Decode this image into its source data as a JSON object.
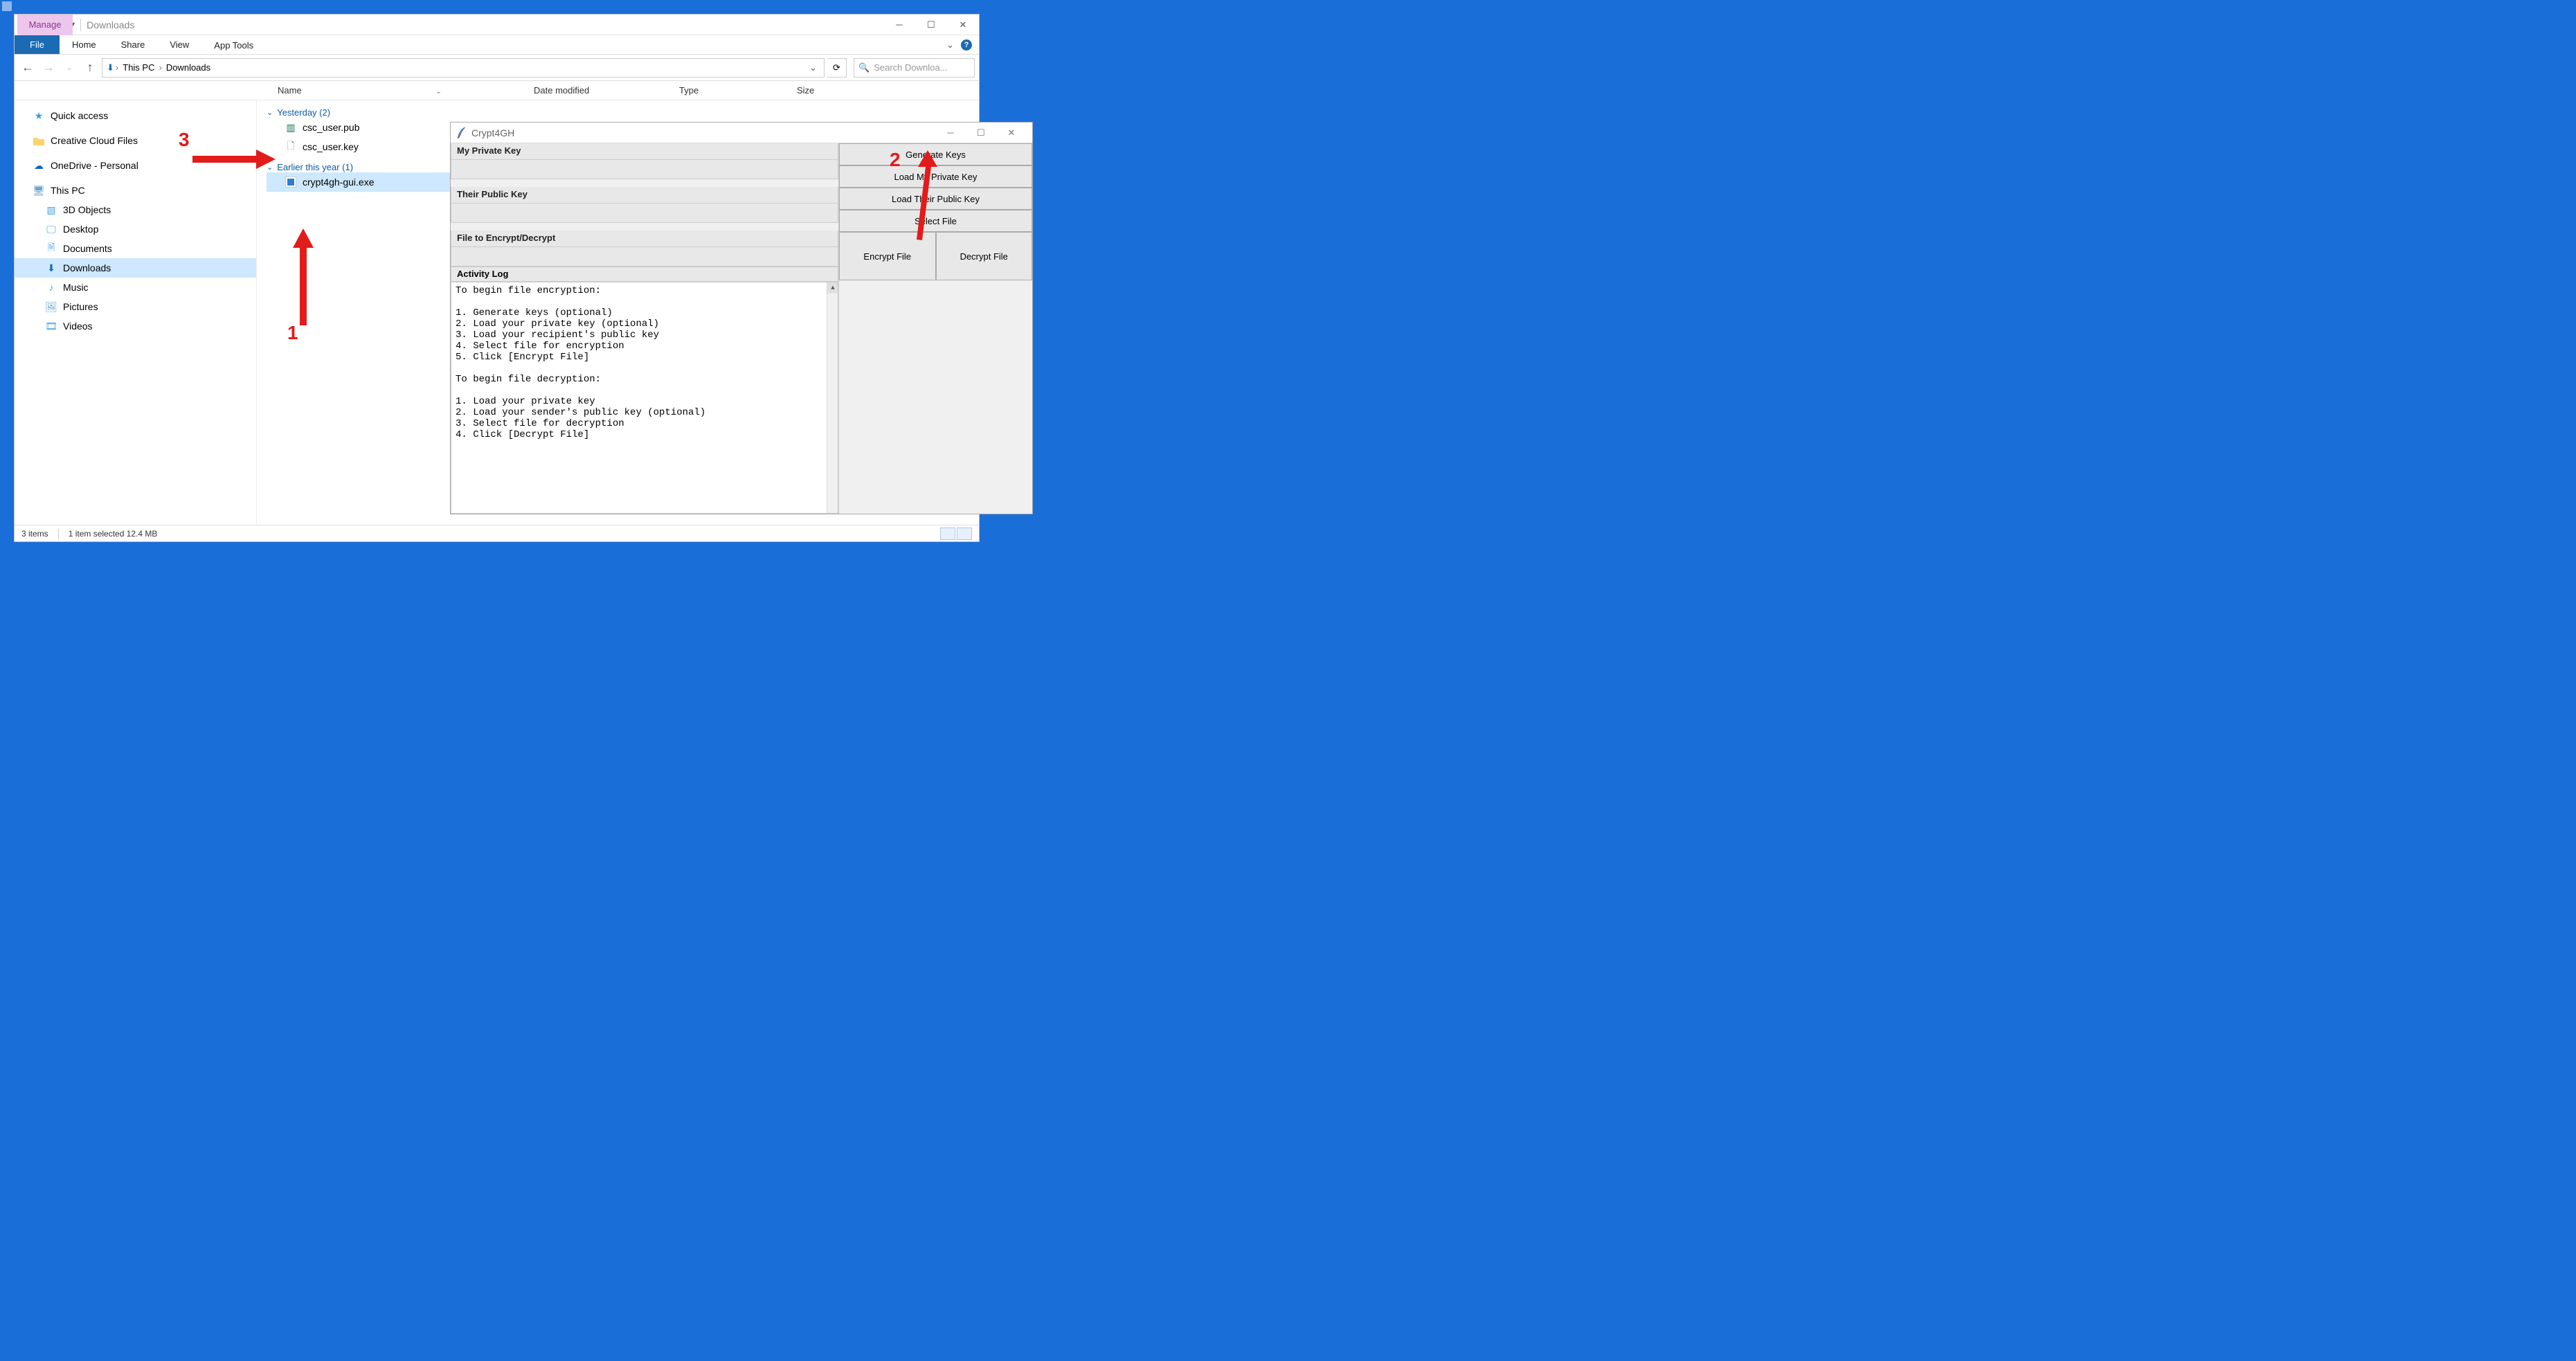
{
  "explorer": {
    "title": "Downloads",
    "manage_label": "Manage",
    "tabs": {
      "file": "File",
      "home": "Home",
      "share": "Share",
      "view": "View",
      "apptools": "App Tools"
    },
    "breadcrumb": {
      "root": "This PC",
      "current": "Downloads"
    },
    "search_placeholder": "Search Downloa...",
    "columns": {
      "name": "Name",
      "date": "Date modified",
      "type": "Type",
      "size": "Size"
    },
    "nav": {
      "quick_access": "Quick access",
      "creative_cloud": "Creative Cloud Files",
      "onedrive": "OneDrive - Personal",
      "this_pc": "This PC",
      "children": {
        "objects3d": "3D Objects",
        "desktop": "Desktop",
        "documents": "Documents",
        "downloads": "Downloads",
        "music": "Music",
        "pictures": "Pictures",
        "videos": "Videos"
      }
    },
    "groups": {
      "yesterday": {
        "label": "Yesterday (2)",
        "files": [
          "csc_user.pub",
          "csc_user.key"
        ]
      },
      "earlier": {
        "label": "Earlier this year (1)",
        "files": [
          "crypt4gh-gui.exe"
        ]
      }
    },
    "status": {
      "items": "3 items",
      "selected": "1 item selected  12.4 MB"
    }
  },
  "crypt": {
    "title": "Crypt4GH",
    "labels": {
      "priv": "My Private Key",
      "pub": "Their Public Key",
      "file": "File to Encrypt/Decrypt",
      "log": "Activity Log"
    },
    "buttons": {
      "gen": "Generate Keys",
      "loadpriv": "Load My Private Key",
      "loadpub": "Load Their Public Key",
      "select": "Select File",
      "encrypt": "Encrypt File",
      "decrypt": "Decrypt File"
    },
    "log": "To begin file encryption:\n\n1. Generate keys (optional)\n2. Load your private key (optional)\n3. Load your recipient's public key\n4. Select file for encryption\n5. Click [Encrypt File]\n\nTo begin file decryption:\n\n1. Load your private key\n2. Load your sender's public key (optional)\n3. Select file for decryption\n4. Click [Decrypt File]"
  },
  "annotations": {
    "one": "1",
    "two": "2",
    "three": "3"
  }
}
